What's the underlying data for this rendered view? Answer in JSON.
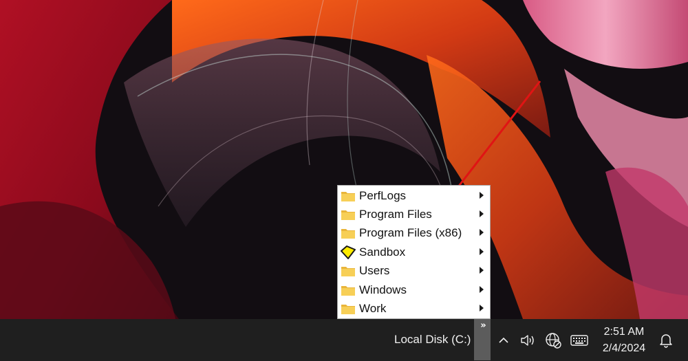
{
  "menu": {
    "items": [
      {
        "label": "PerfLogs",
        "icon": "folder-icon"
      },
      {
        "label": "Program Files",
        "icon": "folder-icon"
      },
      {
        "label": "Program Files (x86)",
        "icon": "folder-icon"
      },
      {
        "label": "Sandbox",
        "icon": "sandbox-diamond-icon"
      },
      {
        "label": "Users",
        "icon": "folder-icon"
      },
      {
        "label": "Windows",
        "icon": "folder-icon"
      },
      {
        "label": "Work",
        "icon": "folder-icon"
      }
    ]
  },
  "taskbar": {
    "toolbar_label": "Local Disk (C:)",
    "toolbar_overflow": "»",
    "tray_icons": [
      "chevron-up-icon",
      "speaker-icon",
      "network-globe-icon",
      "keyboard-icon"
    ],
    "clock": {
      "time": "2:51 AM",
      "date": "2/4/2024"
    },
    "notification_icon": "bell-icon"
  },
  "colors": {
    "taskbar": "#1f1f1f",
    "menu_bg": "#ffffff",
    "folder": "#f5c84c",
    "sandbox": "#ffec00",
    "annotation_arrow": "#e01414"
  }
}
